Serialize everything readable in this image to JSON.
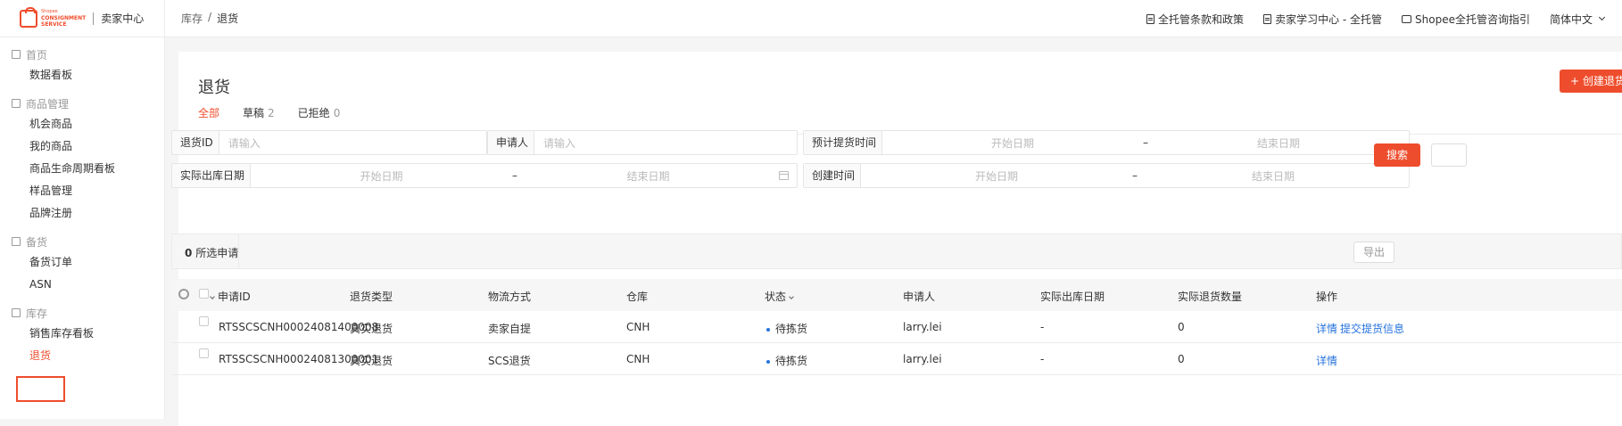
{
  "brand": {
    "logo_small": "Shopee",
    "logo_line1": "CONSIGNMENT",
    "logo_line2": "SERVICE",
    "title": "卖家中心"
  },
  "breadcrumb": {
    "parent": "库存",
    "sep": "/",
    "current": "退货"
  },
  "top_links": [
    {
      "label": "全托管条款和政策"
    },
    {
      "label": "卖家学习中心 - 全托管"
    },
    {
      "label": "Shopee全托管咨询指引"
    },
    {
      "label": "简体中文"
    }
  ],
  "sidebar": {
    "groups": [
      {
        "title": "首页",
        "items": [
          "数据看板"
        ]
      },
      {
        "title": "商品管理",
        "items": [
          "机会商品",
          "我的商品",
          "商品生命周期看板",
          "样品管理",
          "品牌注册"
        ]
      },
      {
        "title": "备货",
        "items": [
          "备货订单",
          "ASN"
        ]
      },
      {
        "title": "库存",
        "items": [
          "销售库存看板",
          "退货"
        ]
      }
    ]
  },
  "page": {
    "title": "退货",
    "create_button": "+ 创建退货"
  },
  "tabs": [
    {
      "label": "全部",
      "count": ""
    },
    {
      "label": "草稿",
      "count": "2"
    },
    {
      "label": "已拒绝",
      "count": "0"
    }
  ],
  "filters": {
    "return_id": {
      "label": "退货ID",
      "placeholder": "请输入"
    },
    "applicant": {
      "label": "申请人",
      "placeholder": "请输入"
    },
    "expected_pickup": {
      "label": "预计提货时间",
      "start": "开始日期",
      "end": "结束日期"
    },
    "actual_outbound": {
      "label": "实际出库日期",
      "start": "开始日期",
      "end": "结束日期"
    },
    "created_time": {
      "label": "创建时间",
      "start": "开始日期",
      "end": "结束日期"
    },
    "range_sep": "–",
    "search_button": "搜索"
  },
  "selection": {
    "count": "0",
    "label": "所选申请",
    "export_button": "导出"
  },
  "table": {
    "columns": [
      "申请ID",
      "退货类型",
      "物流方式",
      "仓库",
      "状态",
      "申请人",
      "实际出库日期",
      "实际退货数量",
      "操作"
    ],
    "rows": [
      {
        "id": "RTSSCSCNH00024081400008",
        "type": "真实退货",
        "logistics": "卖家自提",
        "warehouse": "CNH",
        "status": "待拣货",
        "applicant": "larry.lei",
        "outbound_date": "-",
        "qty": "0",
        "action1": "详情",
        "action2": "提交提货信息"
      },
      {
        "id": "RTSSCSCNH00024081300001",
        "type": "真实退货",
        "logistics": "SCS退货",
        "warehouse": "CNH",
        "status": "待拣货",
        "applicant": "larry.lei",
        "outbound_date": "-",
        "qty": "0",
        "action1": "详情",
        "action2": ""
      }
    ]
  },
  "colors": {
    "accent": "#ee4d2d",
    "link": "#2673dd"
  }
}
